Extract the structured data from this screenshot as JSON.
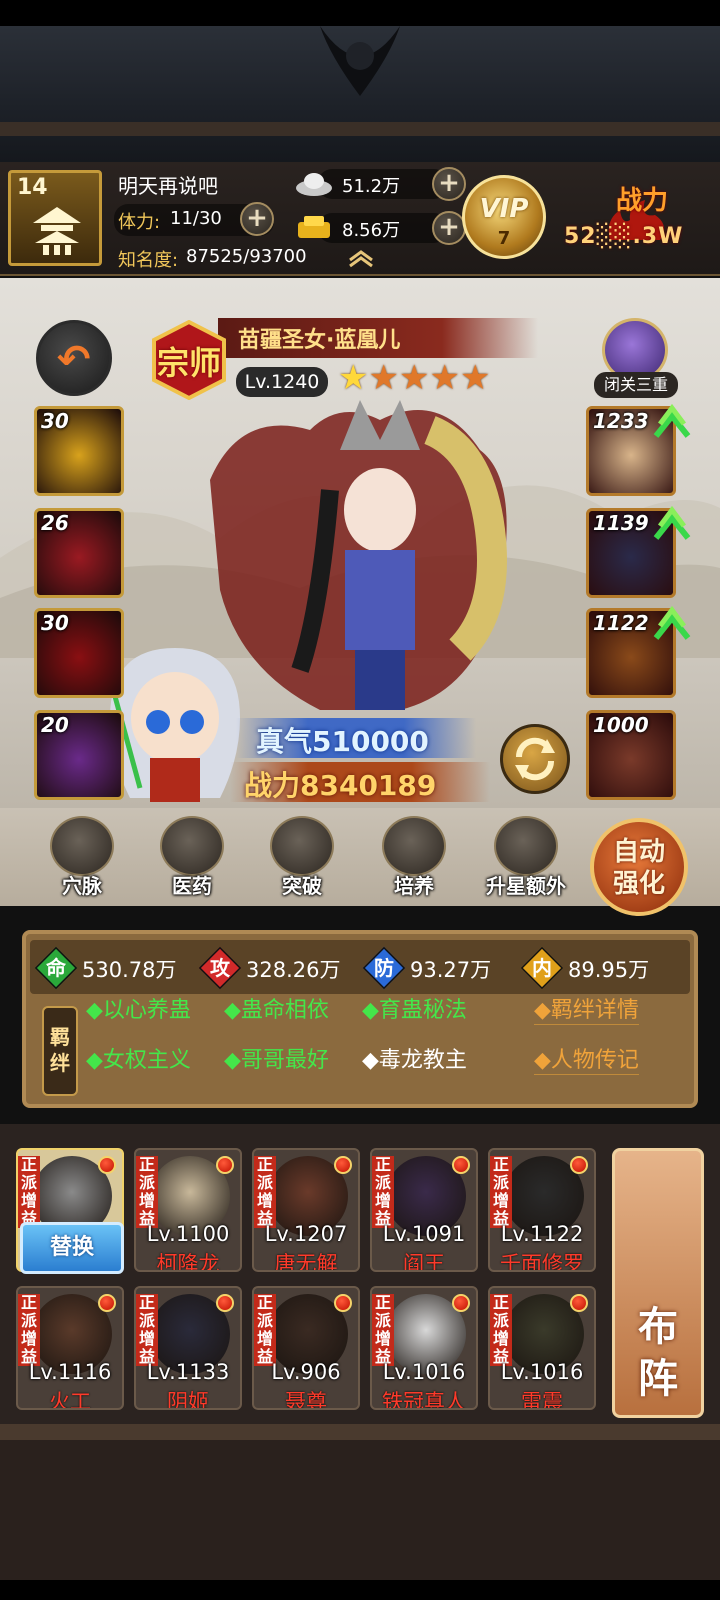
{
  "player": {
    "level": "14",
    "name": "明天再说吧",
    "stamina_label": "体力:",
    "stamina_value": "11/30",
    "fame_label": "知名度:",
    "fame_value": "87525/93700"
  },
  "resources": {
    "silver": "51.2万",
    "gold": "8.56万"
  },
  "vip": {
    "label": "VIP",
    "level": "7"
  },
  "top_power": {
    "label": "战力",
    "value": "52░░.3W"
  },
  "hero": {
    "rank": "宗师",
    "name": "苗疆圣女·蓝凰儿",
    "level": "Lv.1240",
    "stars_filled": 1,
    "stars_total": 5,
    "qi": "真气510000",
    "power": "战力8340189"
  },
  "seclusion": {
    "label": "闭关三重"
  },
  "skills": [
    {
      "level": "30",
      "color": "#d8a21c"
    },
    {
      "level": "26",
      "color": "#9a1a22"
    },
    {
      "level": "30",
      "color": "#8a0f12"
    },
    {
      "level": "20",
      "color": "#6a2a8a"
    }
  ],
  "equipment": [
    {
      "level": "1233",
      "upgradable": true
    },
    {
      "level": "1139",
      "upgradable": true
    },
    {
      "level": "1122",
      "upgradable": true
    },
    {
      "level": "1000",
      "upgradable": false
    }
  ],
  "actions": [
    {
      "label": "穴脉",
      "icon": "meridian-icon"
    },
    {
      "label": "医药",
      "icon": "medicine-icon"
    },
    {
      "label": "突破",
      "icon": "breakthrough-icon"
    },
    {
      "label": "培养",
      "icon": "cultivate-icon"
    },
    {
      "label": "升星额外",
      "icon": "star-up-icon"
    }
  ],
  "auto_enhance": "自动强化",
  "stats": [
    {
      "char": "命",
      "value": "530.78万",
      "color": "#2aa83a"
    },
    {
      "char": "攻",
      "value": "328.26万",
      "color": "#d22a2a"
    },
    {
      "char": "防",
      "value": "93.27万",
      "color": "#2a6ad8"
    },
    {
      "char": "内",
      "value": "89.95万",
      "color": "#e0a01a"
    }
  ],
  "bonds": {
    "label": "羁绊",
    "items": [
      {
        "text": "◆以心养蛊",
        "active": true
      },
      {
        "text": "◆蛊命相依",
        "active": true
      },
      {
        "text": "◆育蛊秘法",
        "active": true
      },
      {
        "text": "◆女权主义",
        "active": true
      },
      {
        "text": "◆哥哥最好",
        "active": true
      },
      {
        "text": "◆毒龙教主",
        "active": false
      }
    ],
    "detail_link": "◆羁绊详情",
    "bio_link": "◆人物传记"
  },
  "team": {
    "replace_label": "替换",
    "tag": "正派增益",
    "members": [
      {
        "level": "",
        "name": "",
        "selected": true
      },
      {
        "level": "Lv.1100",
        "name": "柯降龙"
      },
      {
        "level": "Lv.1207",
        "name": "唐无解"
      },
      {
        "level": "Lv.1091",
        "name": "阎王"
      },
      {
        "level": "Lv.1122",
        "name": "千面修罗"
      },
      {
        "level": "Lv.1116",
        "name": "火工"
      },
      {
        "level": "Lv.1133",
        "name": "阴姬"
      },
      {
        "level": "Lv.906",
        "name": "聂尊"
      },
      {
        "level": "Lv.1016",
        "name": "铁冠真人"
      },
      {
        "level": "Lv.1016",
        "name": "雷震"
      }
    ]
  },
  "formation_label": "布阵"
}
